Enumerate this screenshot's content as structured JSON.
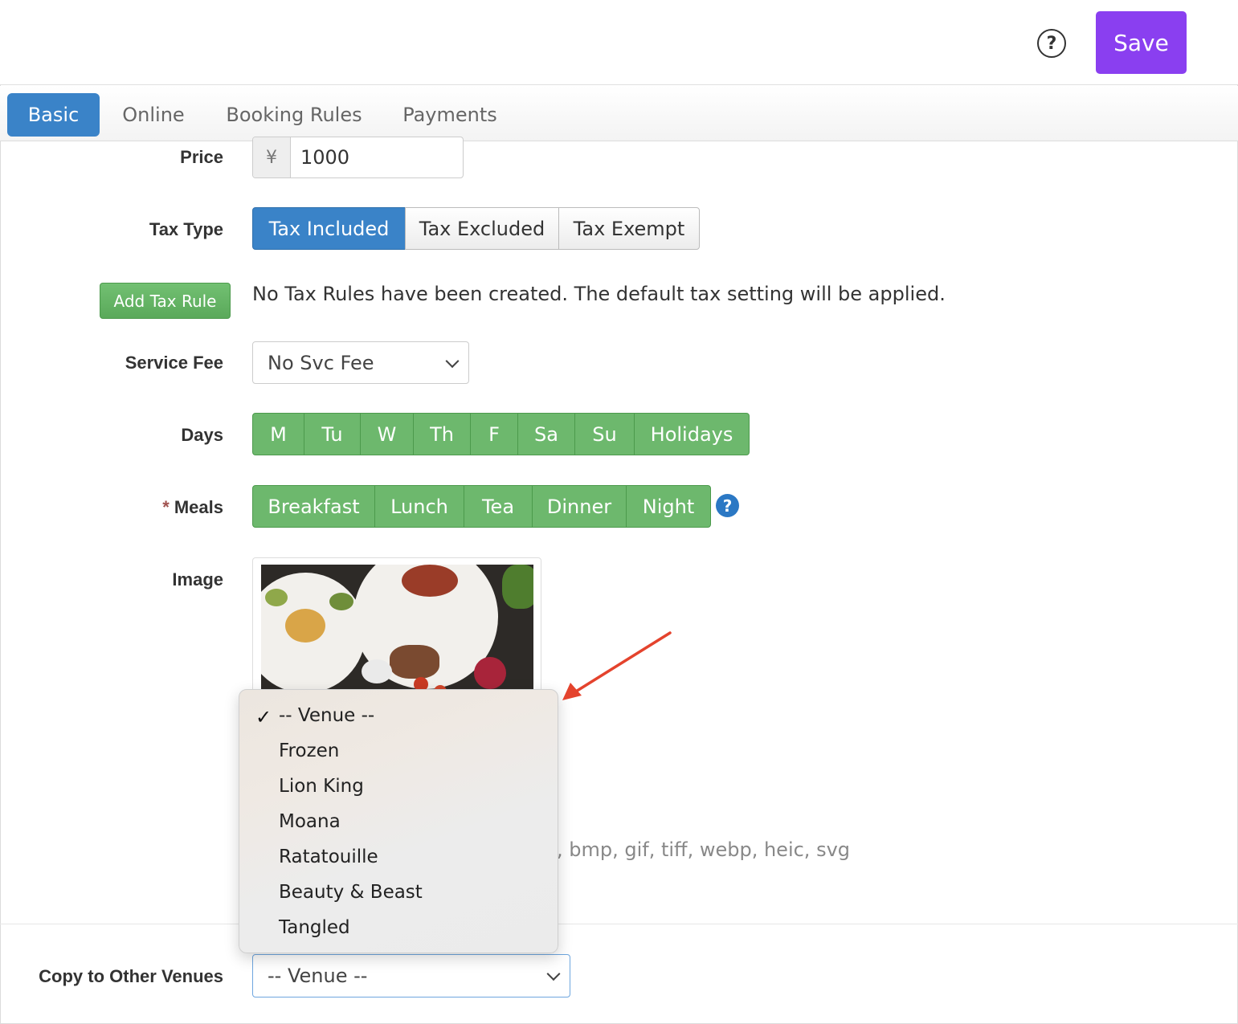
{
  "header": {
    "help_icon": "question-circle-icon",
    "save_label": "Save",
    "save_color": "#8a3ff0"
  },
  "tabs": [
    {
      "label": "Basic",
      "active": true
    },
    {
      "label": "Online",
      "active": false
    },
    {
      "label": "Booking Rules",
      "active": false
    },
    {
      "label": "Payments",
      "active": false
    }
  ],
  "form": {
    "price": {
      "label": "Price",
      "currency_symbol": "¥",
      "value": "1000"
    },
    "tax_type": {
      "label": "Tax Type",
      "options": [
        "Tax Included",
        "Tax Excluded",
        "Tax Exempt"
      ],
      "selected": "Tax Included"
    },
    "tax_rule": {
      "button_label": "Add Tax Rule",
      "note": "No Tax Rules have been created. The default tax setting will be applied."
    },
    "service_fee": {
      "label": "Service Fee",
      "value": "No Svc Fee"
    },
    "days": {
      "label": "Days",
      "options": [
        "M",
        "Tu",
        "W",
        "Th",
        "F",
        "Sa",
        "Su",
        "Holidays"
      ]
    },
    "meals": {
      "label": "Meals",
      "required_marker": "*",
      "options": [
        "Breakfast",
        "Lunch",
        "Tea",
        "Dinner",
        "Night"
      ],
      "help_icon": "question-circle-icon"
    },
    "image": {
      "label": "Image",
      "formats_text": ", bmp, gif, tiff, webp, heic, svg"
    },
    "copy_venues": {
      "label": "Copy to Other Venues",
      "value": "-- Venue --"
    }
  },
  "dropdown": {
    "check_icon": "checkmark-icon",
    "items": [
      "-- Venue --",
      "Frozen",
      "Lion King",
      "Moana",
      "Ratatouille",
      "Beauty & Beast",
      "Tangled"
    ],
    "selected": "-- Venue --"
  },
  "colors": {
    "primary_blue": "#3a83c8",
    "green": "#6db86d",
    "annotation_arrow": "#e4432d"
  }
}
